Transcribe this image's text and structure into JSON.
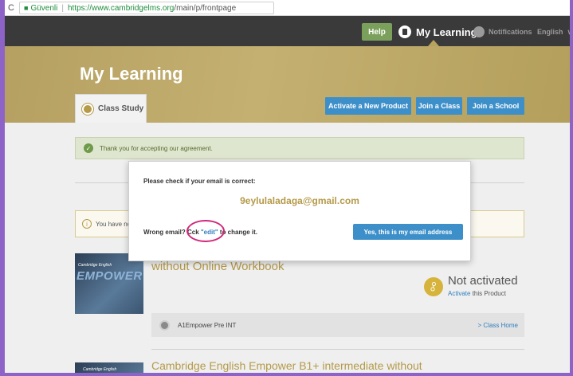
{
  "browser": {
    "secure_label": "Güvenli",
    "url_host": "https://www.cambridgelms.org",
    "url_path": "/main/p/frontpage"
  },
  "topnav": {
    "help": "Help",
    "my_learning": "My Learning",
    "notifications": "Notifications",
    "language": "English"
  },
  "header": {
    "title": "My Learning",
    "tab": "Class Study",
    "buttons": [
      "Activate a New Product",
      "Join a Class",
      "Join a School"
    ]
  },
  "alerts": {
    "agreement": "Thank you for accepting our agreement.",
    "info": "You have no c"
  },
  "dialog": {
    "question": "Please check if your email is correct:",
    "email": "9eylulaladaga@gmail.com",
    "wrong_prefix": "Wrong email? C",
    "wrong_middle": "ck ",
    "edit_link": "\"edit\"",
    "wrong_suffix": " to change it.",
    "confirm": "Yes, this is my email address"
  },
  "product1": {
    "cover_brand": "Cambridge English",
    "cover_title": "EMPOWER",
    "title_visible": "without Online Workbook",
    "status": "Not activated",
    "activate_link": "Activate",
    "activate_suffix": " this Product",
    "class_name": "A1Empower Pre INT",
    "class_home": "> Class Home"
  },
  "product2": {
    "cover_brand": "Cambridge English",
    "title": "Cambridge English Empower B1+ intermediate without"
  },
  "colors": {
    "gold": "#b59a4a",
    "nav_dark": "#3a3a3a",
    "button_blue": "#3d8fc9",
    "help_green": "#7ba05b",
    "frame_purple": "#8e63c8",
    "annotation_pink": "#d0287a"
  },
  "icons": {
    "reload": "reload-icon",
    "lock": "lock-icon",
    "my_learning": "book-icon",
    "notifications": "bell-icon",
    "language": "chevron-down-icon",
    "class_study": "user-icon",
    "agreement": "check-icon",
    "info": "info-icon",
    "not_activated": "link-icon",
    "class": "circle-icon"
  }
}
